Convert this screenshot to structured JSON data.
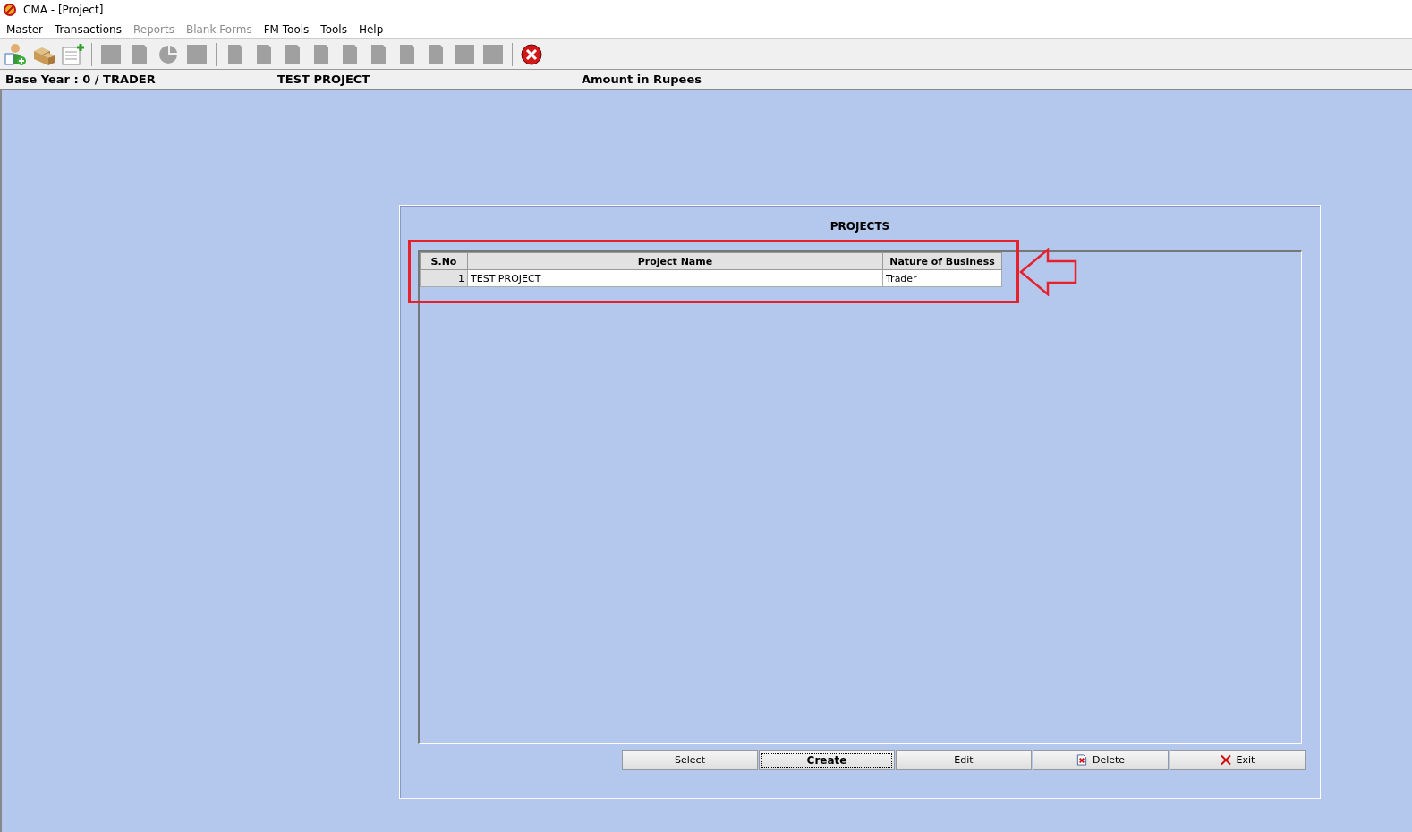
{
  "window": {
    "title": "CMA - [Project]"
  },
  "menu": [
    {
      "label": "Master",
      "disabled": false
    },
    {
      "label": "Transactions",
      "disabled": false
    },
    {
      "label": "Reports",
      "disabled": true
    },
    {
      "label": "Blank Forms",
      "disabled": true
    },
    {
      "label": "FM Tools",
      "disabled": false
    },
    {
      "label": "Tools",
      "disabled": false
    },
    {
      "label": "Help",
      "disabled": false
    }
  ],
  "toolbar": [
    {
      "kind": "user-add"
    },
    {
      "kind": "boxes"
    },
    {
      "kind": "list-add"
    },
    {
      "kind": "separator"
    },
    {
      "kind": "block"
    },
    {
      "kind": "page"
    },
    {
      "kind": "pie"
    },
    {
      "kind": "block"
    },
    {
      "kind": "separator"
    },
    {
      "kind": "page"
    },
    {
      "kind": "page"
    },
    {
      "kind": "page"
    },
    {
      "kind": "page"
    },
    {
      "kind": "page"
    },
    {
      "kind": "page"
    },
    {
      "kind": "page"
    },
    {
      "kind": "page"
    },
    {
      "kind": "block"
    },
    {
      "kind": "block"
    },
    {
      "kind": "separator"
    },
    {
      "kind": "close"
    }
  ],
  "info_bar": {
    "base_year": "Base Year : 0 / TRADER",
    "project": "TEST PROJECT",
    "amount": "Amount in Rupees"
  },
  "panel": {
    "title": "PROJECTS",
    "table": {
      "columns": [
        "S.No",
        "Project Name",
        "Nature of Business"
      ],
      "rows": [
        {
          "cells": [
            "1",
            "TEST PROJECT",
            "Trader"
          ]
        }
      ]
    },
    "buttons": [
      {
        "label": "Select",
        "kind": "plain",
        "focused": false
      },
      {
        "label": "Create",
        "kind": "plain",
        "focused": true
      },
      {
        "label": "Edit",
        "kind": "plain",
        "focused": false
      },
      {
        "label": "Delete",
        "kind": "delete",
        "focused": false
      },
      {
        "label": "Exit",
        "kind": "exit",
        "focused": false
      }
    ]
  }
}
